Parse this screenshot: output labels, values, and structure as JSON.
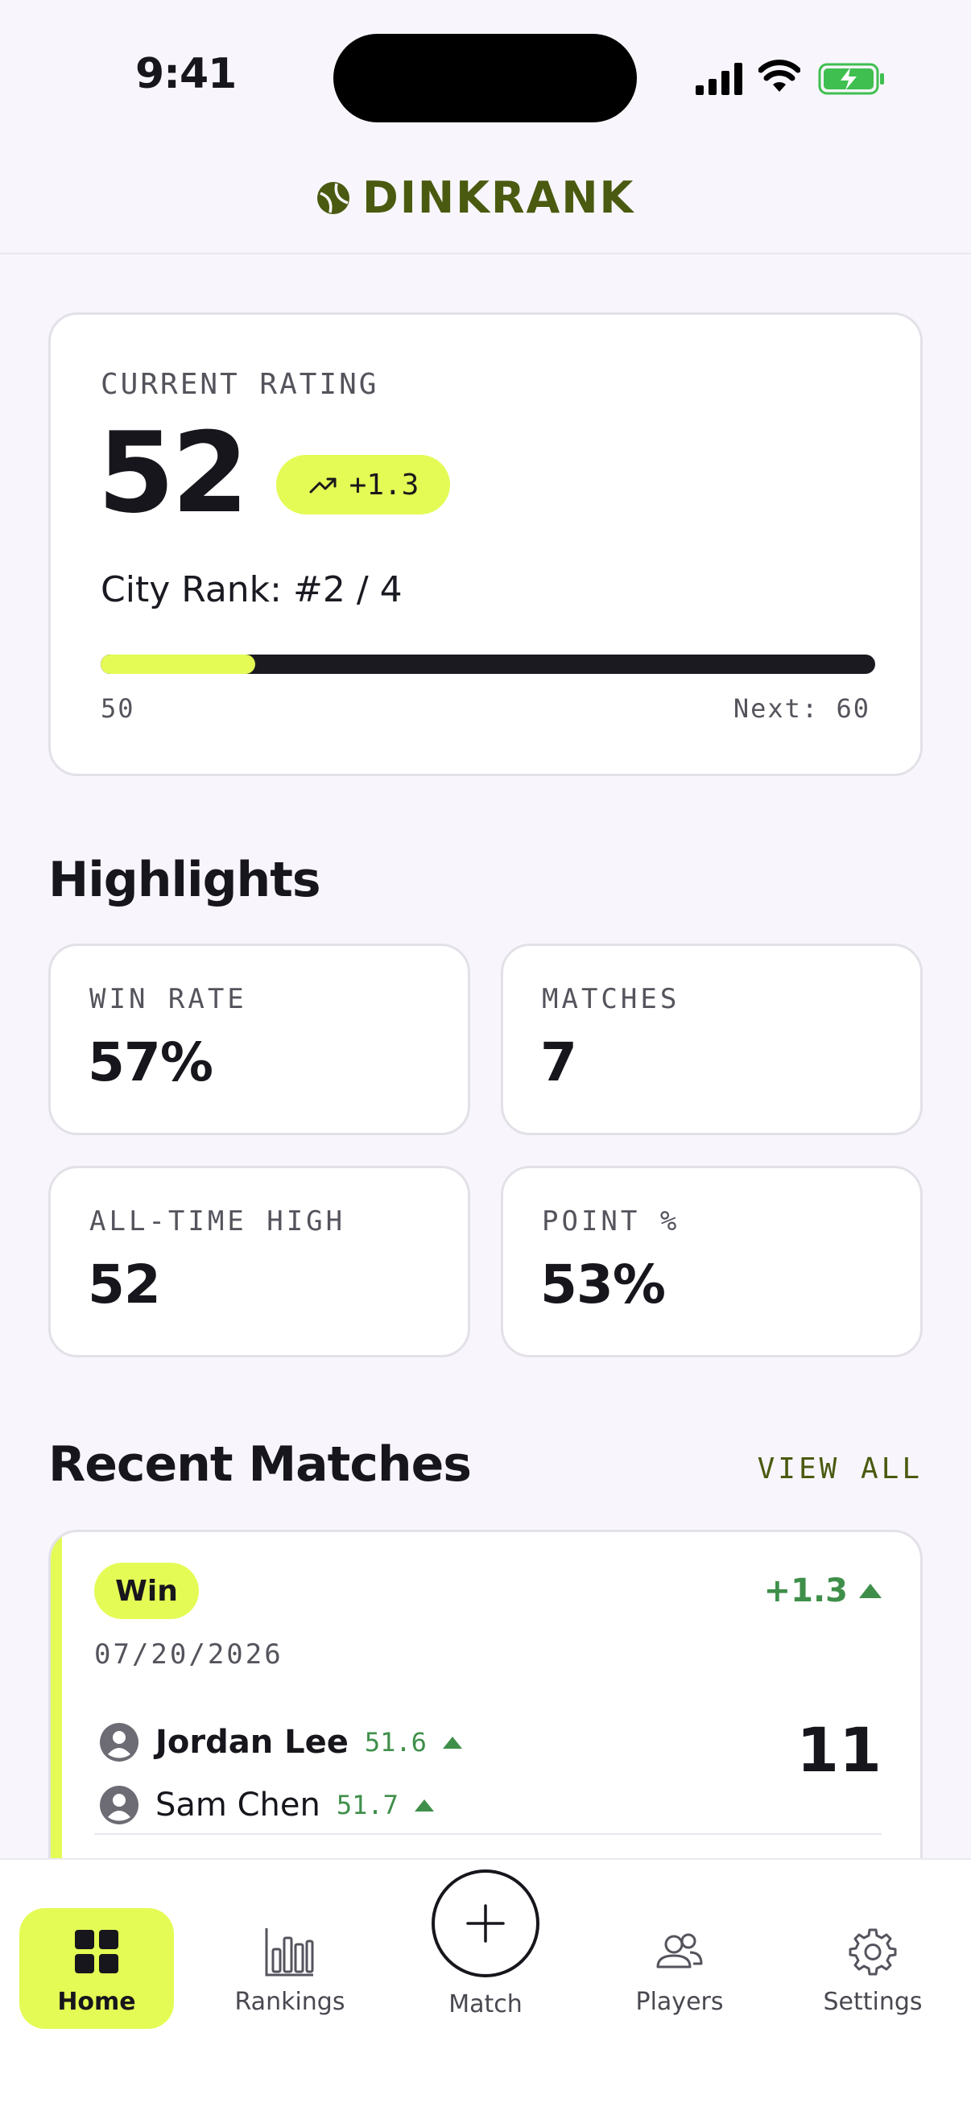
{
  "status_bar": {
    "time": "9:41"
  },
  "header": {
    "app_name": "DINKRANK"
  },
  "rating": {
    "label": "CURRENT RATING",
    "value": "52",
    "delta": "+1.3",
    "city_rank": "City Rank: #2 / 4",
    "progress_min": "50",
    "progress_next": "Next: 60",
    "progress_fraction": 0.2
  },
  "highlights": {
    "title": "Highlights",
    "stats": [
      {
        "label": "WIN RATE",
        "value": "57%"
      },
      {
        "label": "MATCHES",
        "value": "7"
      },
      {
        "label": "ALL-TIME HIGH",
        "value": "52"
      },
      {
        "label": "POINT %",
        "value": "53%"
      }
    ]
  },
  "recent_matches": {
    "title": "Recent Matches",
    "view_all": "VIEW ALL",
    "matches": [
      {
        "result": "Win",
        "delta": "+1.3",
        "date": "07/20/2026",
        "players": [
          {
            "name": "Jordan Lee",
            "rating": "51.6"
          },
          {
            "name": "Sam Chen",
            "rating": "51.7"
          }
        ],
        "score": "11"
      }
    ]
  },
  "nav": {
    "items": [
      {
        "label": "Home",
        "icon": "grid-icon"
      },
      {
        "label": "Rankings",
        "icon": "bar-chart-icon"
      },
      {
        "label": "Match",
        "icon": "plus-icon"
      },
      {
        "label": "Players",
        "icon": "users-icon"
      },
      {
        "label": "Settings",
        "icon": "gear-icon"
      }
    ]
  },
  "colors": {
    "accent": "#e4fb55",
    "brand": "#4a5a10",
    "positive": "#3f8f4a",
    "background": "#f8f6fc"
  }
}
